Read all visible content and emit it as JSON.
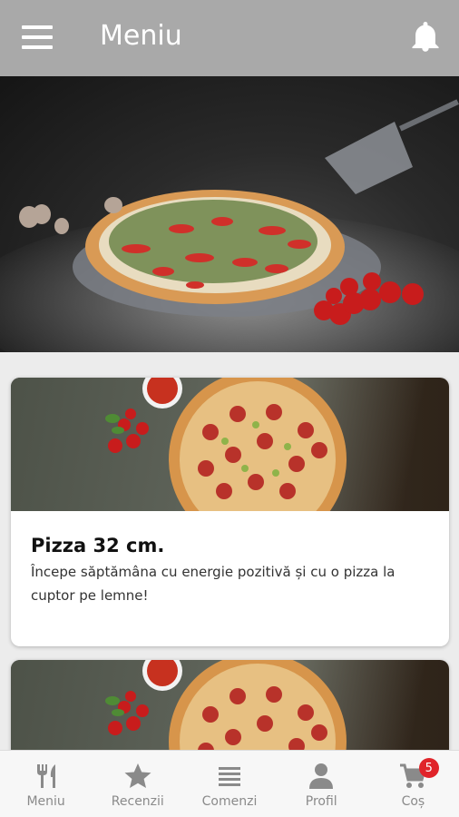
{
  "header": {
    "title": "Meniu",
    "menu_icon": "hamburger-menu-icon",
    "notification_icon": "bell-icon"
  },
  "hero": {
    "image": "pizza-hero-photo"
  },
  "cards": [
    {
      "title": "Pizza 32 cm.",
      "description": "Începe săptămâna cu energie pozitivă și cu o pizza la cuptor pe lemne!"
    },
    {
      "title": "",
      "description": ""
    }
  ],
  "bottom_nav": {
    "items": [
      {
        "label": "Meniu",
        "icon": "fork-knife-icon"
      },
      {
        "label": "Recenzii",
        "icon": "star-icon"
      },
      {
        "label": "Comenzi",
        "icon": "list-icon"
      },
      {
        "label": "Profil",
        "icon": "user-icon"
      },
      {
        "label": "Coș",
        "icon": "cart-icon",
        "badge": "5"
      }
    ]
  },
  "colors": {
    "header_bg": "#a9a9a9",
    "badge_bg": "#e0242a",
    "nav_label": "#8a8a8a"
  }
}
